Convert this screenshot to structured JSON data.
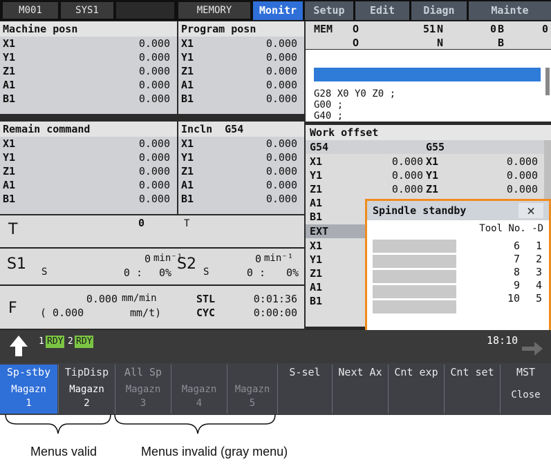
{
  "topbar": {
    "mode": "M001",
    "system": "SYS1",
    "memory": "MEMORY",
    "tabs": [
      {
        "label": "Monitr",
        "active": true
      },
      {
        "label": "Setup",
        "active": false
      },
      {
        "label": "Edit",
        "active": false
      },
      {
        "label": "Diagn",
        "active": false
      },
      {
        "label": "Mainte",
        "active": false
      }
    ]
  },
  "machine_posn": {
    "title": "Machine posn",
    "axes": [
      {
        "axis": "X1",
        "value": "0.000"
      },
      {
        "axis": "Y1",
        "value": "0.000"
      },
      {
        "axis": "Z1",
        "value": "0.000"
      },
      {
        "axis": "A1",
        "value": "0.000"
      },
      {
        "axis": "B1",
        "value": "0.000"
      }
    ]
  },
  "program_posn": {
    "title": "Program posn",
    "axes": [
      {
        "axis": "X1",
        "value": "0.000"
      },
      {
        "axis": "Y1",
        "value": "0.000"
      },
      {
        "axis": "Z1",
        "value": "0.000"
      },
      {
        "axis": "A1",
        "value": "0.000"
      },
      {
        "axis": "B1",
        "value": "0.000"
      }
    ]
  },
  "remain_command": {
    "title": "Remain command",
    "axes": [
      {
        "axis": "X1",
        "value": "0.000"
      },
      {
        "axis": "Y1",
        "value": "0.000"
      },
      {
        "axis": "Z1",
        "value": "0.000"
      },
      {
        "axis": "A1",
        "value": "0.000"
      },
      {
        "axis": "B1",
        "value": "0.000"
      }
    ]
  },
  "incln": {
    "title": "Incln",
    "code": "G54",
    "axes": [
      {
        "axis": "X1",
        "value": "0.000"
      },
      {
        "axis": "Y1",
        "value": "0.000"
      },
      {
        "axis": "Z1",
        "value": "0.000"
      },
      {
        "axis": "A1",
        "value": "0.000"
      },
      {
        "axis": "B1",
        "value": "0.000"
      }
    ]
  },
  "memline": {
    "mem_label": "MEM",
    "row1": {
      "o": "O",
      "o_val": "51",
      "n": "N",
      "n_val": "0",
      "b": "B",
      "b_val": "0"
    },
    "row2": {
      "o": "O",
      "n": "N",
      "b": "B"
    }
  },
  "program": {
    "lines": [
      "G28 X0 Y0 Z0 ;",
      "G00 ;",
      "G40 ;"
    ]
  },
  "work_offset": {
    "title": "Work offset",
    "g54": "G54",
    "g55": "G55",
    "rows_left": [
      {
        "axis": "X1",
        "value": "0.000"
      },
      {
        "axis": "Y1",
        "value": "0.000"
      },
      {
        "axis": "Z1",
        "value": "0.000"
      },
      {
        "axis": "A1",
        "value": ""
      },
      {
        "axis": "B1",
        "value": ""
      }
    ],
    "rows_right": [
      {
        "axis": "X1",
        "value": "0.000"
      },
      {
        "axis": "Y1",
        "value": "0.000"
      },
      {
        "axis": "Z1",
        "value": "0.000"
      }
    ],
    "ext": "EXT",
    "ext_rows": [
      "X1",
      "Y1",
      "Z1",
      "A1",
      "B1"
    ]
  },
  "spindle_standby": {
    "title": "Spindle standby",
    "close": "×",
    "header": "Tool No. -D",
    "rows": [
      {
        "tool": "6",
        "d": "1"
      },
      {
        "tool": "7",
        "d": "2"
      },
      {
        "tool": "8",
        "d": "3"
      },
      {
        "tool": "9",
        "d": "4"
      },
      {
        "tool": "10",
        "d": "5"
      }
    ]
  },
  "tool": {
    "label": "T",
    "value": "0",
    "t2": "T"
  },
  "spindle": {
    "s1": {
      "label": "S1",
      "s": "S",
      "speed": "0",
      "unit": "min⁻¹",
      "load": "0 :",
      "pct": "0%"
    },
    "s2": {
      "label": "S2",
      "s": "S",
      "speed": "0",
      "unit": "min⁻¹",
      "load": "0 :",
      "pct": "0%"
    }
  },
  "feed": {
    "label": "F",
    "value": "0.000",
    "unit": "mm/min",
    "sub_value": "( 0.000",
    "sub_unit": "mm/t)"
  },
  "times": {
    "stl_label": "STL",
    "stl": "0:01:36",
    "cyc_label": "CYC",
    "cyc": "0:00:00"
  },
  "status": {
    "r1n": "1",
    "r1": "RDY",
    "r2n": "2",
    "r2": "RDY",
    "clock": "18:10"
  },
  "menu": [
    {
      "top": "Sp-stby",
      "bottom": [
        "Magazn",
        "1"
      ],
      "enabled": true,
      "selected": true
    },
    {
      "top": "TipDisp",
      "bottom": [
        "Magazn",
        "2"
      ],
      "enabled": true,
      "selected": false
    },
    {
      "top": "All Sp",
      "bottom": [
        "Magazn",
        "3"
      ],
      "enabled": false,
      "selected": false
    },
    {
      "top": "",
      "bottom": [
        "Magazn",
        "4"
      ],
      "enabled": false,
      "selected": false
    },
    {
      "top": "",
      "bottom": [
        "Magazn",
        "5"
      ],
      "enabled": false,
      "selected": false
    },
    {
      "top": "S-sel",
      "bottom": [
        "",
        ""
      ],
      "enabled": true,
      "selected": false
    },
    {
      "top": "Next Ax",
      "bottom": [
        "",
        ""
      ],
      "enabled": true,
      "selected": false
    },
    {
      "top": "Cnt exp",
      "bottom": [
        "",
        ""
      ],
      "enabled": true,
      "selected": false
    },
    {
      "top": "Cnt set",
      "bottom": [
        "",
        ""
      ],
      "enabled": true,
      "selected": false
    },
    {
      "top": "MST",
      "bottom": [
        "Close",
        ""
      ],
      "enabled": true,
      "selected": false
    }
  ],
  "captions": {
    "valid": "Menus valid",
    "invalid": "Menus invalid (gray menu)"
  },
  "colors": {
    "active_tab": "#2f6fd8",
    "rdy": "#7cc544",
    "popup_border": "#f08c1e",
    "menu_selected": "#2f6fd8"
  }
}
